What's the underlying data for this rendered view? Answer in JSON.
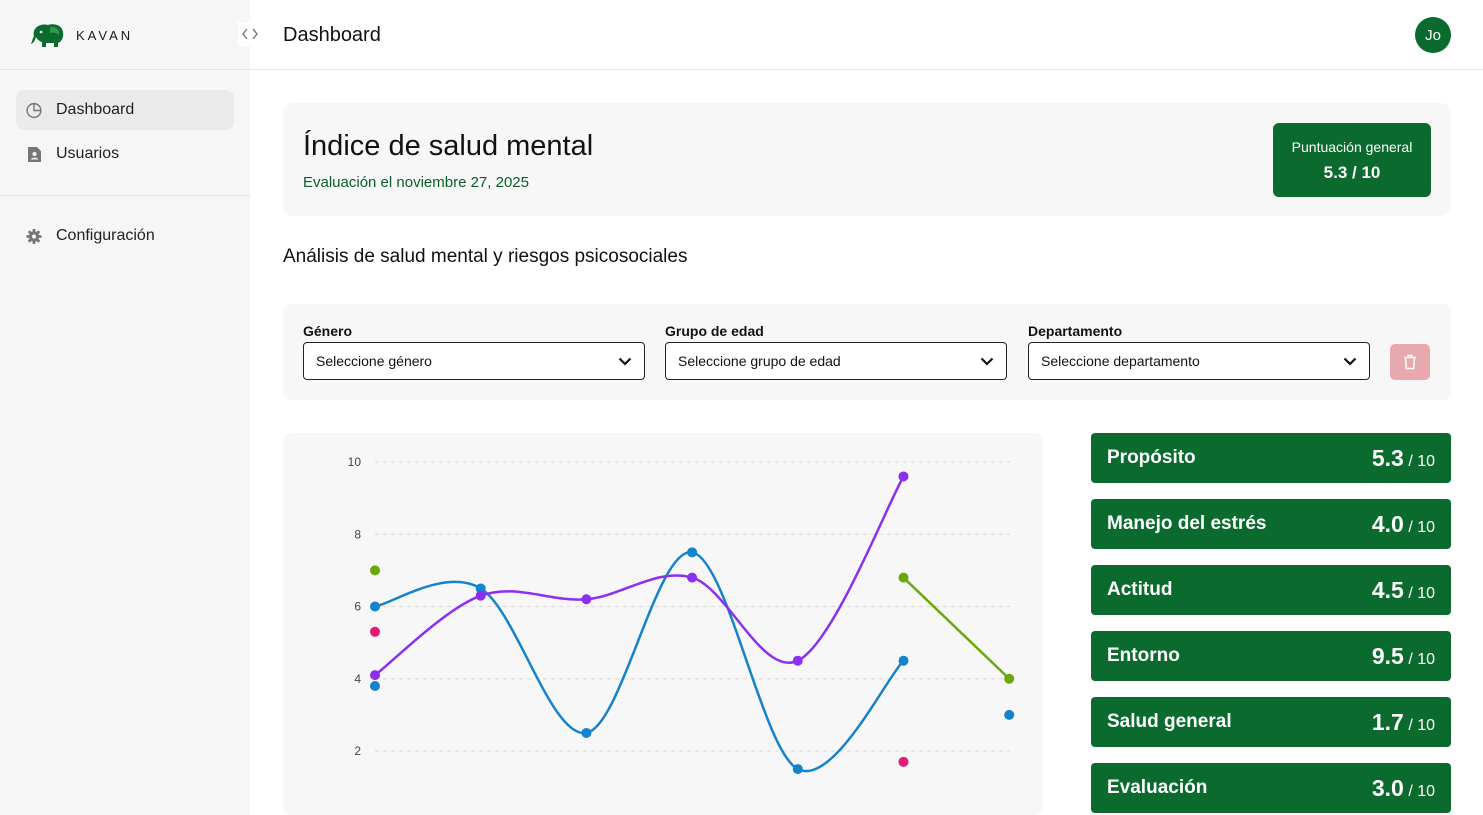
{
  "brand": {
    "name": "KAVAN"
  },
  "sidebar": {
    "items": [
      {
        "label": "Dashboard",
        "icon": "pie-chart-icon",
        "active": true
      },
      {
        "label": "Usuarios",
        "icon": "document-user-icon",
        "active": false
      }
    ],
    "settings": {
      "label": "Configuración",
      "icon": "gear-icon"
    }
  },
  "header": {
    "title": "Dashboard",
    "avatar_initials": "Jo"
  },
  "hero": {
    "title": "Índice de salud mental",
    "subtitle": "Evaluación el noviembre 27, 2025",
    "score_label": "Puntuación general",
    "score_value": "5.3 / 10"
  },
  "section_title": "Análisis de salud mental y riesgos psicosociales",
  "filters": {
    "gender": {
      "label": "Género",
      "value": "Seleccione género"
    },
    "age": {
      "label": "Grupo de edad",
      "value": "Seleccione grupo de edad"
    },
    "department": {
      "label": "Departamento",
      "value": "Seleccione departamento"
    }
  },
  "metrics": [
    {
      "name": "Propósito",
      "value": "5.3",
      "denom": "/ 10"
    },
    {
      "name": "Manejo del estrés",
      "value": "4.0",
      "denom": "/ 10"
    },
    {
      "name": "Actitud",
      "value": "4.5",
      "denom": "/ 10"
    },
    {
      "name": "Entorno",
      "value": "9.5",
      "denom": "/ 10"
    },
    {
      "name": "Salud general",
      "value": "1.7",
      "denom": "/ 10"
    },
    {
      "name": "Evaluación",
      "value": "3.0",
      "denom": "/ 10"
    }
  ],
  "colors": {
    "brand_green": "#0b6b2e",
    "subtitle_green": "#0b5e29",
    "trash_bg": "#e8a9ae",
    "series_blue": "#1482cc",
    "series_purple": "#8b2ff0",
    "series_green": "#6aa80a",
    "series_pink": "#e0197a"
  },
  "chart_data": {
    "type": "line",
    "ylim": [
      1,
      10.5
    ],
    "yticks": [
      2,
      4,
      6,
      8,
      10
    ],
    "x": [
      0,
      1,
      2,
      3,
      4,
      5,
      6
    ],
    "grid": true,
    "series": [
      {
        "color": "#1482cc",
        "values": [
          6.0,
          6.5,
          2.5,
          7.5,
          1.5,
          4.5,
          null
        ],
        "smooth": true
      },
      {
        "color": "#8b2ff0",
        "values": [
          4.1,
          6.3,
          6.2,
          6.8,
          4.5,
          9.6,
          null
        ],
        "smooth": true
      },
      {
        "color": "#6aa80a",
        "values": [
          7.0,
          null,
          null,
          null,
          null,
          6.8,
          4.0
        ],
        "smooth": false
      },
      {
        "color": "#e0197a",
        "values": [
          5.3,
          null,
          null,
          null,
          null,
          1.7,
          null
        ],
        "smooth": false
      },
      {
        "color": "#1482cc",
        "values": [
          3.8,
          null,
          null,
          null,
          null,
          null,
          3.0
        ],
        "smooth": false,
        "points_only": true
      }
    ]
  }
}
